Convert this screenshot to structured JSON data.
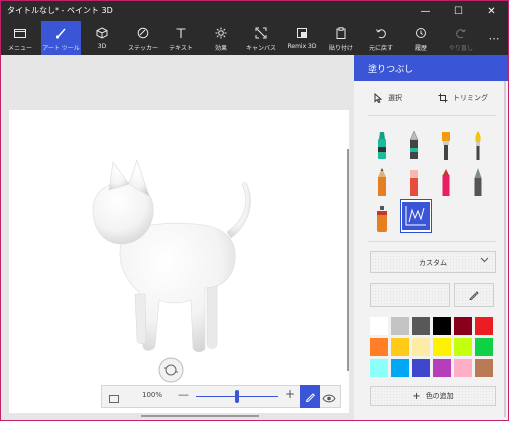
{
  "app": {
    "title": "タイトルなし* - ペイント 3D"
  },
  "window_controls": {
    "minimize": "—",
    "maximize": "☐",
    "close": "✕"
  },
  "toolbar": {
    "menu": "メニュー",
    "art_tools": "アート ツール",
    "three_d": "3D",
    "stickers": "ステッカー",
    "text": "テキスト",
    "effects": "効果",
    "canvas": "キャンバス",
    "remix3d": "Remix 3D",
    "paste": "貼り付け",
    "undo": "元に戻す",
    "history": "履歴",
    "redo": "やり直し",
    "more": "⋯"
  },
  "zoom": {
    "percent": "100%",
    "minus": "—",
    "plus": "+",
    "level": 0.5
  },
  "panel": {
    "title": "塗りつぶし",
    "select": "選択",
    "crop": "トリミング",
    "brushes": [
      "marker",
      "calligraphy-pen",
      "oil-brush",
      "watercolor",
      "pencil",
      "eraser",
      "crayon",
      "pixel-pen",
      "spray-can",
      "fill"
    ],
    "selected_brush": "fill",
    "dropdown": "カスタム",
    "add_color": "色の追加",
    "swatches": [
      "#ffffff",
      "#c3c3c3",
      "#585858",
      "#000000",
      "#88001b",
      "#ec1c24",
      "#ff7f27",
      "#ffca18",
      "#fdeca6",
      "#fff200",
      "#c4ff0e",
      "#0ed145",
      "#8cfffb",
      "#00a8f3",
      "#3f48cc",
      "#b83dba",
      "#ffaec8",
      "#b97a56"
    ],
    "accent": "#3a56d6"
  }
}
